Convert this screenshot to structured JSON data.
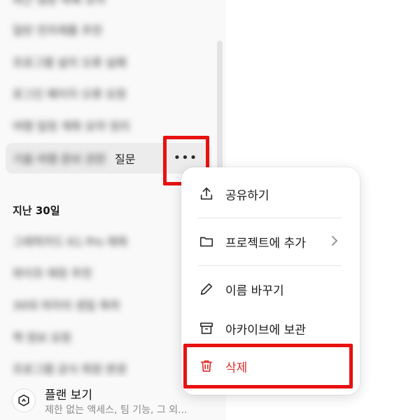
{
  "sidebar": {
    "partial_top_item": "최근 질문 목록 요약",
    "history_recent": [
      {
        "label": "일반 전자제품 추천"
      },
      {
        "label": "프로그램 설치 오류 실패"
      },
      {
        "label": "로그인 페이지 오류 요청"
      },
      {
        "label": "여행 일정 계획 요약 정리"
      }
    ],
    "active_item": {
      "label_blurred": "가을 여행 준비 관련",
      "label_visible": "질문",
      "more_glyph": "•••"
    },
    "section_last30": "지난 30일",
    "history_30days": [
      {
        "label": "그래픽카드 K1 Pro 제목"
      },
      {
        "label": "와이프 애칭 추천"
      },
      {
        "label": "30대 여자의 생일 축하"
      },
      {
        "label": "책 정보 요청"
      },
      {
        "label": "프로그램 공식 회원 변경"
      }
    ],
    "plan": {
      "title": "플랜 보기",
      "subtitle": "제한 없는 액세스, 팀 기능, 그 외..."
    }
  },
  "context_menu": {
    "share": "공유하기",
    "add_to_project": "프로젝트에 추가",
    "rename": "이름 바꾸기",
    "archive": "아카이브에 보관",
    "delete": "삭제"
  },
  "colors": {
    "highlight_box": "#e81010",
    "delete_text": "#e02e2a",
    "sidebar_bg": "#f9f9f9",
    "active_row_bg": "#ececec"
  }
}
